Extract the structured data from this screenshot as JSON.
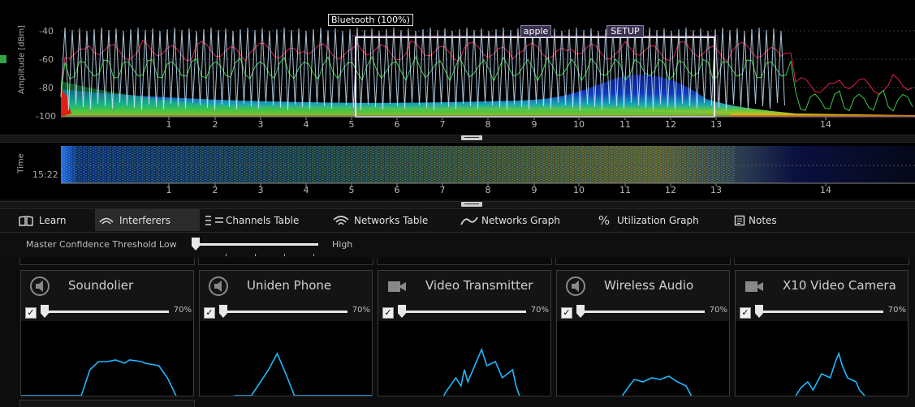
{
  "spectrum": {
    "y_axis_label": "Amplitude [dBm]",
    "y_ticks": [
      "-40",
      "-60",
      "-80",
      "-100"
    ],
    "x_ticks": [
      "1",
      "2",
      "3",
      "4",
      "5",
      "6",
      "7",
      "8",
      "9",
      "10",
      "11",
      "12",
      "13",
      "14"
    ],
    "annotations": [
      "Bluetooth (100%)",
      "apple",
      "SETUP"
    ]
  },
  "waterfall": {
    "y_axis_label": "Time",
    "time_tick": "15:22",
    "x_ticks": [
      "1",
      "2",
      "3",
      "4",
      "5",
      "6",
      "7",
      "8",
      "9",
      "10",
      "11",
      "12",
      "13",
      "14"
    ]
  },
  "tabs": [
    {
      "label": "Learn",
      "icon": "book-icon"
    },
    {
      "label": "Interferers",
      "icon": "wireless-icon",
      "active": true
    },
    {
      "label": "Channels Table",
      "icon": "list-icon"
    },
    {
      "label": "Networks Table",
      "icon": "wifi-icon"
    },
    {
      "label": "Networks Graph",
      "icon": "wave-icon"
    },
    {
      "label": "Utilization Graph",
      "icon": "percent-icon"
    },
    {
      "label": "Notes",
      "icon": "notes-icon"
    }
  ],
  "threshold": {
    "label": "Master Confidence Threshold",
    "low": "Low",
    "high": "High",
    "level": 0.0
  },
  "interferers": [
    {
      "name": "Soundolier",
      "icon": "speaker-icon",
      "percent": "70%",
      "checked": true,
      "level": 0.0
    },
    {
      "name": "Uniden Phone",
      "icon": "speaker-icon",
      "percent": "70%",
      "checked": true,
      "level": 0.0
    },
    {
      "name": "Video Transmitter",
      "icon": "camera-icon",
      "percent": "70%",
      "checked": true,
      "level": 0.0
    },
    {
      "name": "Wireless Audio",
      "icon": "speaker-icon",
      "percent": "70%",
      "checked": true,
      "level": 0.0
    },
    {
      "name": "X10 Video Camera",
      "icon": "camera-icon",
      "percent": "70%",
      "checked": true,
      "level": 0.0
    }
  ],
  "colors": {
    "accent_cyan": "#1fb8ff",
    "bluetooth_box": "#ffffff",
    "spectrum_red": "#e0204a",
    "spectrum_green": "#3cc84a"
  }
}
